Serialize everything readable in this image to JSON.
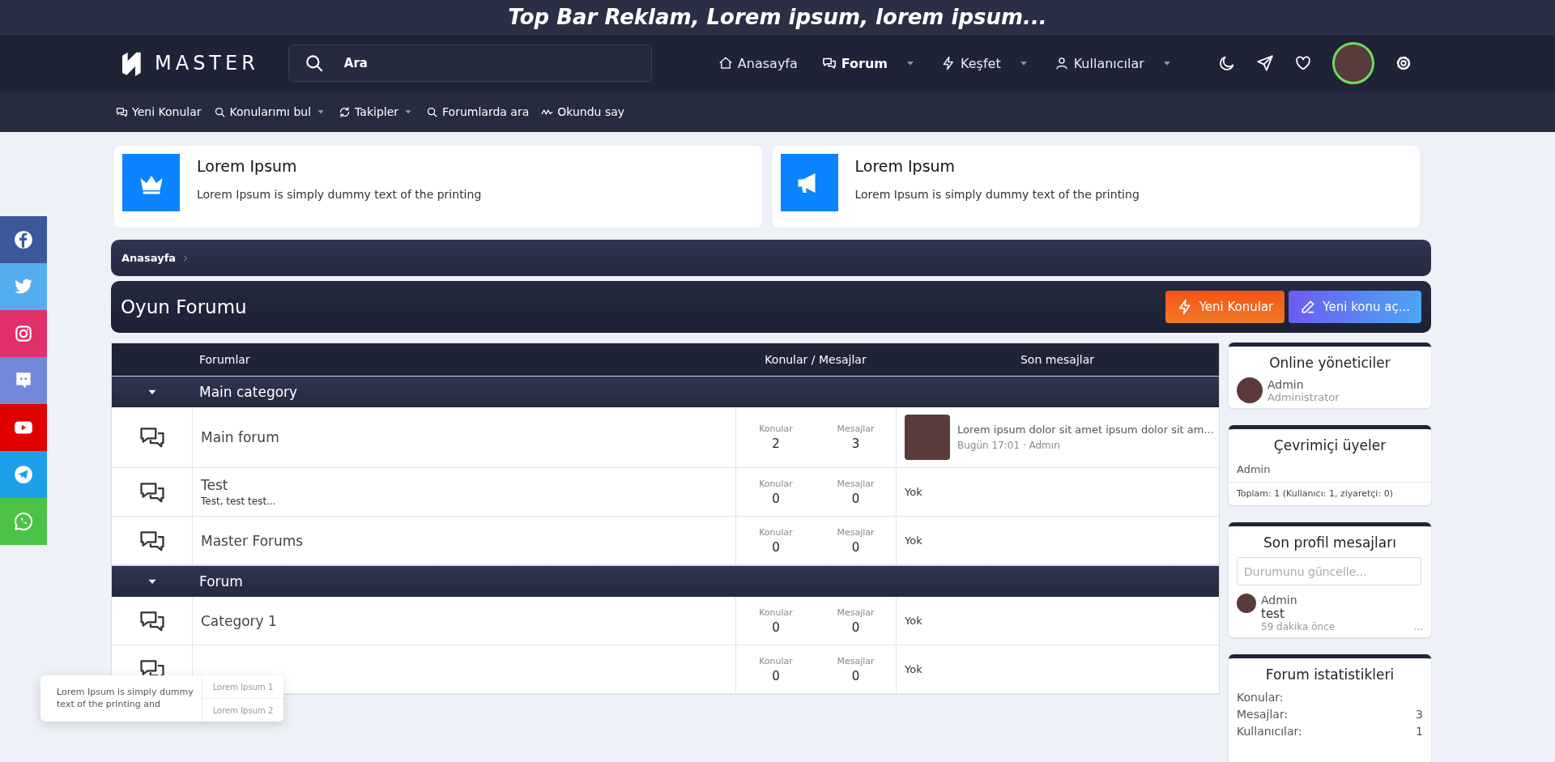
{
  "top_banner": {
    "text": "Top Bar Reklam, Lorem ipsum, lorem ipsum..."
  },
  "header": {
    "logo": "MASTER",
    "search": {
      "placeholder": "Ara"
    },
    "nav": [
      {
        "label": "Anasayfa",
        "selected": false,
        "dropdown": false
      },
      {
        "label": "Forum",
        "selected": true,
        "dropdown": true
      },
      {
        "label": "Keşfet",
        "selected": false,
        "dropdown": true
      },
      {
        "label": "Kullanıcılar",
        "selected": false,
        "dropdown": true
      }
    ]
  },
  "subnav": [
    {
      "label": "Yeni Konular",
      "dropdown": false
    },
    {
      "label": "Konularımı bul",
      "dropdown": true
    },
    {
      "label": "Takipler",
      "dropdown": true
    },
    {
      "label": "Forumlarda ara",
      "dropdown": false
    },
    {
      "label": "Okundu say",
      "dropdown": false
    }
  ],
  "promo_cards": [
    {
      "title": "Lorem Ipsum",
      "text": "Lorem Ipsum is simply dummy text of the printing"
    },
    {
      "title": "Lorem Ipsum",
      "text": "Lorem Ipsum is simply dummy text of the printing"
    }
  ],
  "breadcrumb": [
    "Anasayfa"
  ],
  "page_title": "Oyun Forumu",
  "actions": [
    {
      "label": "Yeni Konular",
      "kind": "latest"
    },
    {
      "label": "Yeni konu aç...",
      "kind": "create"
    }
  ],
  "forum_table": {
    "columns": [
      "Forumlar",
      "Konular / Mesajlar",
      "Son mesajlar"
    ],
    "categories": [
      {
        "title": "Main category",
        "expanded": true,
        "forums": [
          {
            "title": "Main forum",
            "threads_label": "Konular",
            "threads": "2",
            "messages_label": "Mesajlar",
            "messages": "3",
            "last_post": {
              "kind": "post",
              "title": "Lorem ipsum dolor sit amet ipsum dolor sit am...",
              "meta": "Bugün 17:01 · Admın"
            }
          },
          {
            "title": "Test",
            "description": "Test, test test...",
            "threads_label": "Konular",
            "threads": "0",
            "messages_label": "Mesajlar",
            "messages": "0",
            "last_post": {
              "kind": "none",
              "text": "Yok"
            }
          },
          {
            "title": "Master Forums",
            "threads_label": "Konular",
            "threads": "0",
            "messages_label": "Mesajlar",
            "messages": "0",
            "last_post": {
              "kind": "none",
              "text": "Yok"
            }
          }
        ]
      },
      {
        "title": "Forum",
        "expanded": true,
        "forums": [
          {
            "title": "Category 1",
            "threads_label": "Konular",
            "threads": "0",
            "messages_label": "Mesajlar",
            "messages": "0",
            "last_post": {
              "kind": "none",
              "text": "Yok"
            }
          },
          {
            "threads_label": "Konular",
            "threads": "0",
            "messages_label": "Mesajlar",
            "messages": "0",
            "last_post": {
              "kind": "none",
              "text": "Yok"
            }
          }
        ]
      }
    ]
  },
  "sidebar": [
    {
      "kind": "staff",
      "title": "Online yöneticiler",
      "members": [
        {
          "name": "Admin",
          "role": "Administrator"
        }
      ]
    },
    {
      "kind": "online",
      "title": "Çevrimiçi üyeler",
      "members": [
        "Admin"
      ],
      "footer": "Toplam: 1 (Kullanıcı: 1, ziyaretçi: 0)"
    },
    {
      "kind": "profile_posts",
      "title": "Son profil mesajları",
      "placeholder": "Durumunu güncelle...",
      "posts": [
        {
          "author": "Admin",
          "text": "test",
          "time": "59 dakika önce",
          "more": "..."
        }
      ]
    },
    {
      "kind": "stats",
      "title": "Forum istatistikleri",
      "rows": [
        {
          "label": "Konular:"
        },
        {
          "label": "Mesajlar:",
          "value": "3"
        },
        {
          "label": "Kullanıcılar:",
          "value": "1"
        }
      ]
    }
  ],
  "social": [
    {
      "color": "#3b5998"
    },
    {
      "color": "#55acee"
    },
    {
      "color": "#e1306c"
    },
    {
      "color": "#7289da"
    },
    {
      "color": "#e00000"
    },
    {
      "color": "#1ca1e8"
    },
    {
      "color": "#4cc247"
    }
  ],
  "popup": {
    "text": "Lorem Ipsum is simply dummy text of the printing and",
    "links": [
      "Lorem Ipsum 1",
      "Lorem Ipsum 2"
    ]
  }
}
